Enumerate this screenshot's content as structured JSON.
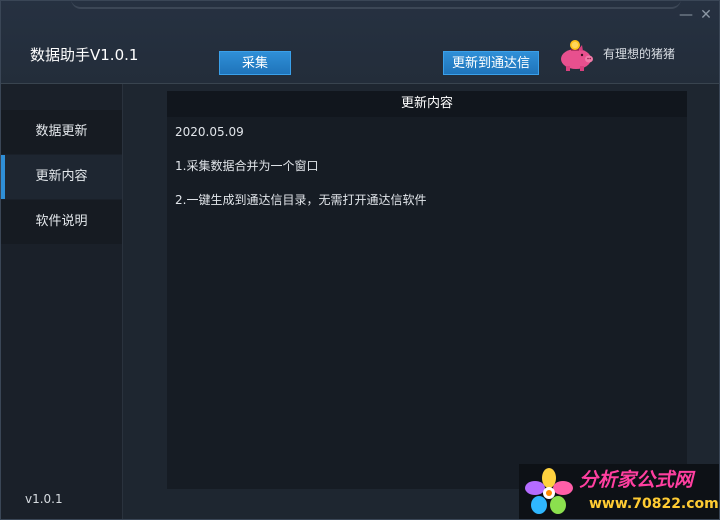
{
  "app": {
    "title": "数据助手V1.0.1",
    "version": "v1.0.1"
  },
  "toolbar": {
    "collect_label": "采集",
    "update_label": "更新到通达信"
  },
  "user": {
    "name": "有理想的猪猪",
    "avatar_icon": "piggy-bank-icon"
  },
  "window_controls": {
    "minimize": "—",
    "close": "✕"
  },
  "sidebar": {
    "items": [
      {
        "label": "数据更新",
        "active": false
      },
      {
        "label": "更新内容",
        "active": true
      },
      {
        "label": "软件说明",
        "active": false
      }
    ]
  },
  "content": {
    "header": "更新内容",
    "lines": [
      "2020.05.09",
      "1.采集数据合并为一个窗口",
      "2.一键生成到通达信目录，无需打开通达信软件"
    ]
  },
  "watermark": {
    "text": "分析家公式网",
    "url": "www.70822.com"
  },
  "colors": {
    "accent": "#2f8fd7",
    "background": "#1e2630",
    "brand_pink": "#ff3fa0"
  }
}
